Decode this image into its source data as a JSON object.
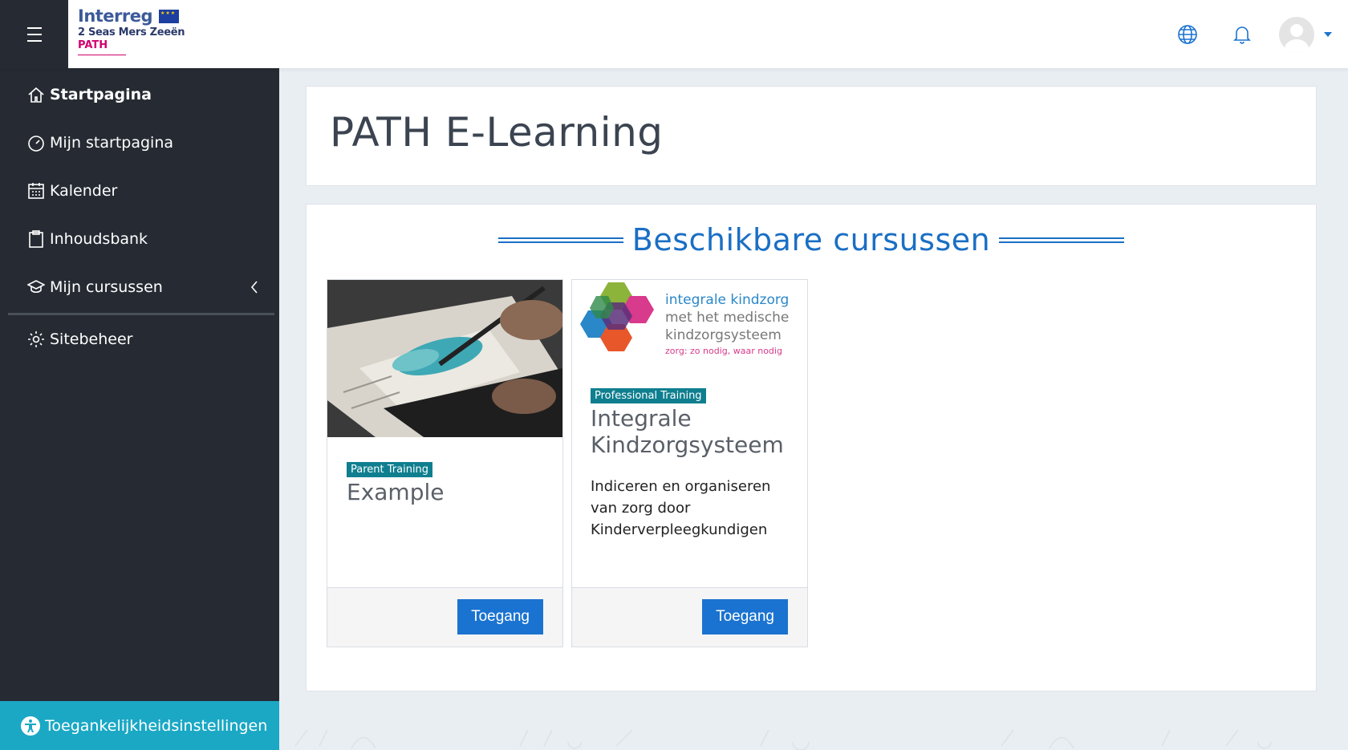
{
  "topbar": {
    "logo": {
      "brand": "Interreg",
      "line2": "2 Seas Mers Zeeën",
      "line3": "PATH"
    }
  },
  "sidebar": {
    "items": [
      {
        "label": "Startpagina",
        "icon": "home-icon",
        "active": true
      },
      {
        "label": "Mijn startpagina",
        "icon": "dashboard-gauge-icon"
      },
      {
        "label": "Kalender",
        "icon": "calendar-icon"
      },
      {
        "label": "Inhoudsbank",
        "icon": "clipboard-icon"
      },
      {
        "label": "Mijn cursussen",
        "icon": "graduation-cap-icon"
      },
      {
        "label": "Sitebeheer",
        "icon": "gear-icon"
      }
    ],
    "accessibility_label": "Toegankelijkheidsinstellingen"
  },
  "main": {
    "page_title": "PATH E-Learning",
    "section_heading": "Beschikbare cursussen",
    "courses": [
      {
        "category": "Parent Training",
        "title": "Example",
        "description": "",
        "button_label": "Toegang"
      },
      {
        "category": "Professional Training",
        "title": "Integrale Kindzorgsysteem",
        "description": "Indiceren en organiseren van zorg door Kinderverpleegkundigen",
        "button_label": "Toegang",
        "image_text": {
          "line1": "integrale kindzorg",
          "line2": "met het medische",
          "line3": "kindzorgsysteem",
          "line4": "zorg: zo nodig, waar nodig"
        }
      }
    ]
  },
  "colors": {
    "sidebar_bg": "#262b33",
    "accent_blue": "#1a73d0",
    "badge_teal": "#0f7f8f",
    "accessibility_bar": "#1aa8c5"
  }
}
